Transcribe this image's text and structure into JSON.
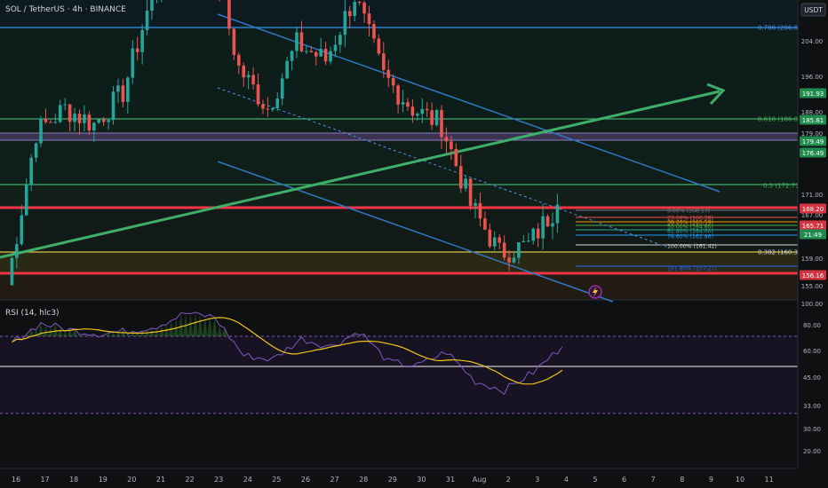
{
  "header": {
    "symbol": "SOL / TetherUS · 4h · BINANCE",
    "currency": "USDT"
  },
  "colors": {
    "background": "#0f1012",
    "up": "#26a69a",
    "down": "#ef5350",
    "fib_blue": "#2962ff",
    "fib_green": "#2fbf71",
    "trend_green": "#3fae6a",
    "channel_blue": "#2f78c4",
    "support_red": "#f23645",
    "rsi": "#7e57c2",
    "rsi_ma": "#f0c419"
  },
  "price_axis": {
    "ticks": [
      "204.00",
      "196.00",
      "188.00",
      "179.00",
      "171.00",
      "167.00",
      "163.00",
      "159.00",
      "155.00",
      "100.00"
    ],
    "badges": [
      {
        "label": "191.93",
        "color": "#1f8b4c"
      },
      {
        "label": "185.81",
        "color": "#1f8b4c"
      },
      {
        "label": "179.49",
        "color": "#1f8b4c"
      },
      {
        "label": "176.49",
        "color": "#1f8b4c"
      },
      {
        "label": "168.20",
        "color": "#d4343f"
      },
      {
        "label": "165.71",
        "color": "#d4343f"
      },
      {
        "label": "21:49",
        "color": "#1f8b4c"
      },
      {
        "label": "156.16",
        "color": "#d4343f"
      }
    ]
  },
  "fib_labels": [
    {
      "text": "0.786 (206.85)",
      "color": "#4a90e2"
    },
    {
      "text": "0.618 (186.05)",
      "color": "#4caf50"
    },
    {
      "text": "0.5 (172.71)",
      "color": "#4caf50"
    },
    {
      "text": "0.382 (160.32)",
      "color": "#d1d4dc"
    },
    {
      "text": "0.00% (168.17)",
      "color": "#787b86"
    },
    {
      "text": "23.60% (166.58)",
      "color": "#ef5350"
    },
    {
      "text": "38.20% (165.59)",
      "color": "#ff9800"
    },
    {
      "text": "50.00% (164.80)",
      "color": "#4caf50"
    },
    {
      "text": "61.80% (164.00)",
      "color": "#26a69a"
    },
    {
      "text": "78.60% (162.86)",
      "color": "#2196f3"
    },
    {
      "text": "100.00% (161.42)",
      "color": "#d1d4dc"
    },
    {
      "text": "161.80% (157.27)",
      "color": "#2962ff"
    }
  ],
  "rsi": {
    "title": "RSI (14, hlc3)",
    "ticks": [
      "80.00",
      "60.00",
      "45.00",
      "33.00",
      "30.00",
      "20.00"
    ]
  },
  "chart_data": {
    "type": "candlestick",
    "x_ticks": [
      "16",
      "17",
      "18",
      "19",
      "20",
      "21",
      "22",
      "23",
      "24",
      "25",
      "26",
      "27",
      "28",
      "29",
      "30",
      "31",
      "Aug",
      "2",
      "3",
      "4",
      "5",
      "6",
      "7",
      "8",
      "9",
      "10",
      "11"
    ],
    "price_key_points": [
      {
        "x": "16",
        "close": 156
      },
      {
        "x": "17",
        "close": 175
      },
      {
        "x": "18",
        "close": 178
      },
      {
        "x": "19",
        "close": 176
      },
      {
        "x": "20",
        "close": 180
      },
      {
        "x": "21",
        "close": 192
      },
      {
        "x": "22",
        "close": 201
      },
      {
        "x": "23",
        "close": 198
      },
      {
        "x": "24",
        "close": 183
      },
      {
        "x": "25",
        "close": 178
      },
      {
        "x": "26",
        "close": 186
      },
      {
        "x": "27",
        "close": 184
      },
      {
        "x": "28",
        "close": 192
      },
      {
        "x": "29",
        "close": 182
      },
      {
        "x": "30",
        "close": 178
      },
      {
        "x": "31",
        "close": 176
      },
      {
        "x": "Aug",
        "close": 166
      },
      {
        "x": "2",
        "close": 160
      },
      {
        "x": "3",
        "close": 161
      },
      {
        "x": "4",
        "close": 166
      }
    ],
    "rsi_key_points": [
      {
        "x": "16",
        "rsi": 55
      },
      {
        "x": "17",
        "rsi": 70
      },
      {
        "x": "18",
        "rsi": 65
      },
      {
        "x": "19",
        "rsi": 62
      },
      {
        "x": "20",
        "rsi": 64
      },
      {
        "x": "21",
        "rsi": 68
      },
      {
        "x": "22",
        "rsi": 78
      },
      {
        "x": "23",
        "rsi": 75
      },
      {
        "x": "24",
        "rsi": 45
      },
      {
        "x": "25",
        "rsi": 42
      },
      {
        "x": "26",
        "rsi": 58
      },
      {
        "x": "27",
        "rsi": 52
      },
      {
        "x": "28",
        "rsi": 64
      },
      {
        "x": "29",
        "rsi": 40
      },
      {
        "x": "30",
        "rsi": 37
      },
      {
        "x": "31",
        "rsi": 48
      },
      {
        "x": "Aug",
        "rsi": 25
      },
      {
        "x": "2",
        "rsi": 18
      },
      {
        "x": "3",
        "rsi": 32
      },
      {
        "x": "4",
        "rsi": 52
      }
    ]
  }
}
